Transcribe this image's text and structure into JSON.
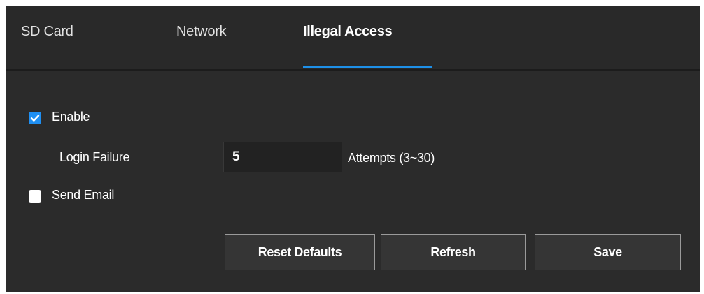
{
  "tabs": [
    {
      "label": "SD Card",
      "active": false
    },
    {
      "label": "Network",
      "active": false
    },
    {
      "label": "Illegal Access",
      "active": true
    }
  ],
  "form": {
    "enable": {
      "label": "Enable",
      "checked": true
    },
    "login_failure": {
      "label": "Login Failure",
      "value": "5",
      "suffix": "Attempts (3~30)"
    },
    "send_email": {
      "label": "Send Email",
      "checked": false
    }
  },
  "buttons": {
    "reset": "Reset Defaults",
    "refresh": "Refresh",
    "save": "Save"
  },
  "colors": {
    "accent": "#1e90e8",
    "panel_background": "#2b2b2b",
    "checkbox_checked": "#1f8ff2"
  },
  "icons": {
    "checkmark": "check-icon"
  }
}
